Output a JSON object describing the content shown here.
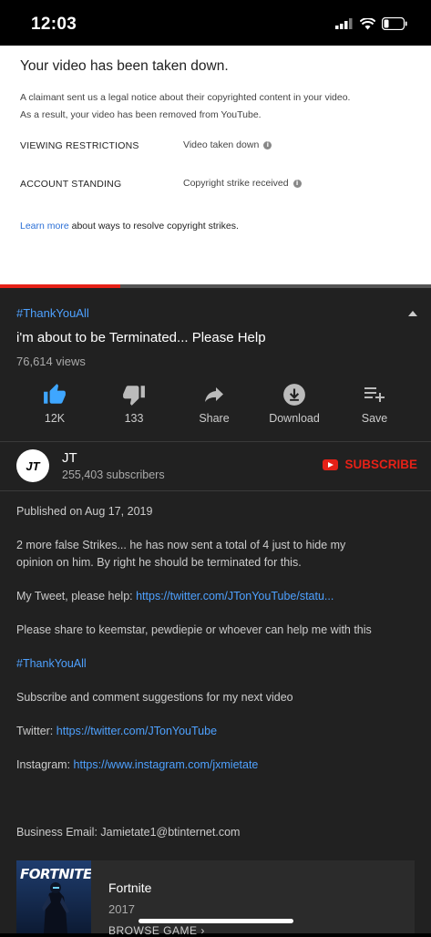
{
  "status_bar": {
    "time": "12:03"
  },
  "notice": {
    "title": "Your video has been taken down.",
    "line1": "A claimant sent us a legal notice about their copyrighted content in your video.",
    "line2": "As a result, your video has been removed from YouTube.",
    "rows": [
      {
        "label": "VIEWING RESTRICTIONS",
        "value": "Video taken down"
      },
      {
        "label": "ACCOUNT STANDING",
        "value": "Copyright strike received"
      }
    ],
    "learn_link": "Learn more",
    "learn_text": " about ways to resolve copyright strikes."
  },
  "video": {
    "hashtag": "#ThankYouAll",
    "title": "i'm about to be Terminated... Please Help",
    "views": "76,614 views",
    "actions": {
      "like": "12K",
      "dislike": "133",
      "share": "Share",
      "download": "Download",
      "save": "Save"
    },
    "progress_fraction": 0.28
  },
  "channel": {
    "avatar_text": "JT",
    "name": "JT",
    "subscribers": "255,403 subscribers",
    "subscribe_label": "SUBSCRIBE"
  },
  "description": {
    "published": "Published on Aug 17, 2019",
    "p1_line1": "2 more false Strikes... he has now sent a total of 4 just to hide my",
    "p1_line2": "opinion on him. By right he should be terminated for this.",
    "tweet_label": "My Tweet, please help: ",
    "tweet_link": "https://twitter.com/JTonYouTube/statu...",
    "share_text": "Please share to keemstar, pewdiepie or whoever can help me with this",
    "hashtag": "#ThankYouAll",
    "subscribe_text": "Subscribe and comment suggestions for my next video",
    "twitter_label": "Twitter: ",
    "twitter_link": "https://twitter.com/JTonYouTube",
    "instagram_label": "Instagram: ",
    "instagram_link": "https://www.instagram.com/jxmietate",
    "email": "Business Email: Jamietate1@btinternet.com"
  },
  "game": {
    "cover_logo": "FORTNITE",
    "name": "Fortnite",
    "year": "2017",
    "browse": "BROWSE GAME"
  },
  "colors": {
    "accent_red": "#e62117",
    "link_blue": "#4ea1ff",
    "dark_bg": "#212121"
  }
}
